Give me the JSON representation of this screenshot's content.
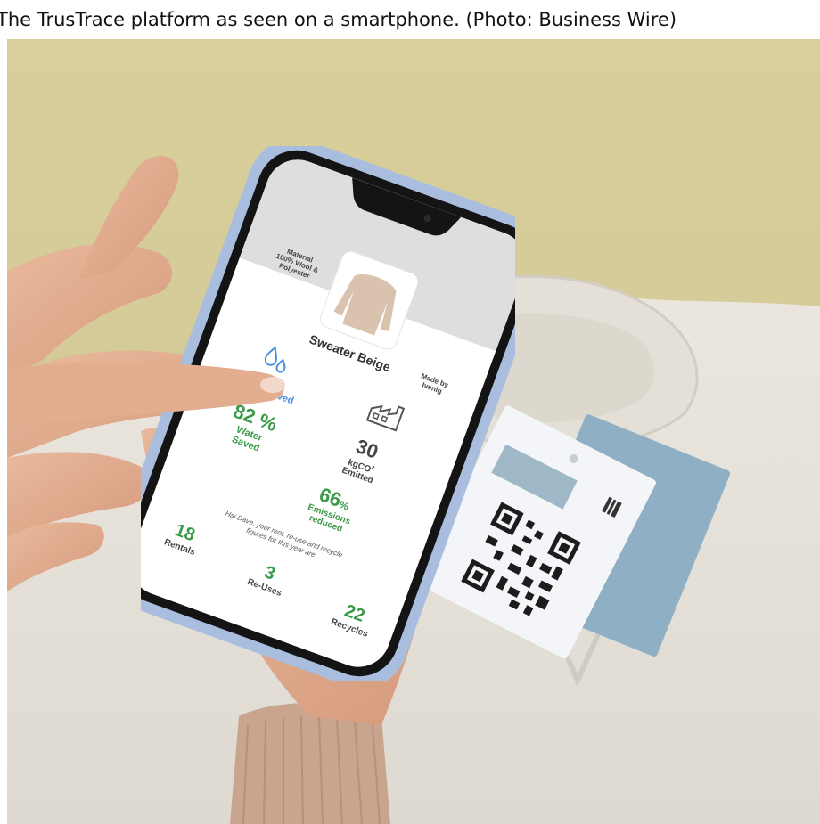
{
  "caption": "The TrusTrace platform as seen on a smartphone. (Photo: Business Wire)",
  "app": {
    "material_label": "Material",
    "material_value_1": "100% Wool &",
    "material_value_2": "Polyester",
    "product_name": "Sweater Beige",
    "made_by_label": "Made by",
    "made_by_value": "Ivenig",
    "water_stat": "82 %",
    "water_label_1": "Water",
    "water_label_2": "Saved",
    "water_partial": "ved",
    "co2_stat": "30",
    "co2_label_1": "kgCO",
    "co2_label_2": "Emitted",
    "emissions_stat": "66",
    "emissions_unit": "%",
    "emissions_label_1": "Emissions",
    "emissions_label_2": "reduced",
    "greeting": "Hai Dave, your rent, re-use and recycle",
    "greeting_2": "figures for this year are",
    "rentals_value": "18",
    "rentals_label": "Rentals",
    "reuses_value": "3",
    "reuses_label": "Re-Uses",
    "recycles_value": "22",
    "recycles_label": "Recycles"
  },
  "colors": {
    "background_wall": "#d6cc99",
    "shirt": "#e8e4dc",
    "phone_case": "#a9bedf",
    "accent_green": "#3a9a47",
    "tag_blue": "#8fb0c4"
  }
}
